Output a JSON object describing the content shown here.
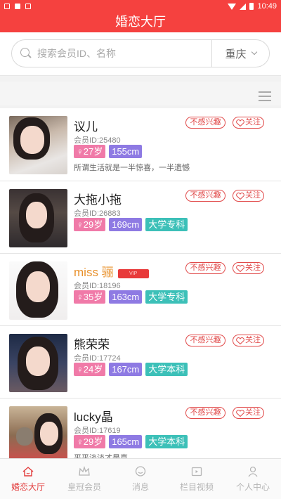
{
  "status": {
    "time": "10:49"
  },
  "header": {
    "title": "婚恋大厅"
  },
  "search": {
    "placeholder": "搜索会员ID、名称",
    "city": "重庆"
  },
  "actions": {
    "not_interested": "不感兴趣",
    "follow": "关注"
  },
  "members": [
    {
      "name": "议儿",
      "id_label": "会员ID:25480",
      "age": "♀27岁",
      "height": "155cm",
      "education": "",
      "motto": "所谓生活就是一半惊喜，一半遗憾",
      "vip": false
    },
    {
      "name": "大拖小拖",
      "id_label": "会员ID:26883",
      "age": "♀29岁",
      "height": "169cm",
      "education": "大学专科",
      "motto": "",
      "vip": false
    },
    {
      "name": "miss 骊",
      "id_label": "会员ID:18196",
      "age": "♀35岁",
      "height": "163cm",
      "education": "大学专科",
      "motto": "",
      "vip": true
    },
    {
      "name": "熊荣荣",
      "id_label": "会员ID:17724",
      "age": "♀24岁",
      "height": "167cm",
      "education": "大学本科",
      "motto": "",
      "vip": false
    },
    {
      "name": "lucky晶",
      "id_label": "会员ID:17619",
      "age": "♀29岁",
      "height": "165cm",
      "education": "大学本科",
      "motto": "平平淡淡才是真",
      "vip": false
    }
  ],
  "tabbar": [
    {
      "label": "婚恋大厅",
      "icon": "home-icon",
      "active": true
    },
    {
      "label": "皇冠会员",
      "icon": "crown-icon",
      "active": false
    },
    {
      "label": "消息",
      "icon": "message-icon",
      "active": false
    },
    {
      "label": "栏目视频",
      "icon": "video-icon",
      "active": false
    },
    {
      "label": "个人中心",
      "icon": "user-icon",
      "active": false
    }
  ],
  "colors": {
    "brand": "#f5413f",
    "age_tag": "#f07aa8",
    "height_tag": "#8e7ae3",
    "edu_tag": "#3cc0b8",
    "vip_name": "#e8902a"
  }
}
